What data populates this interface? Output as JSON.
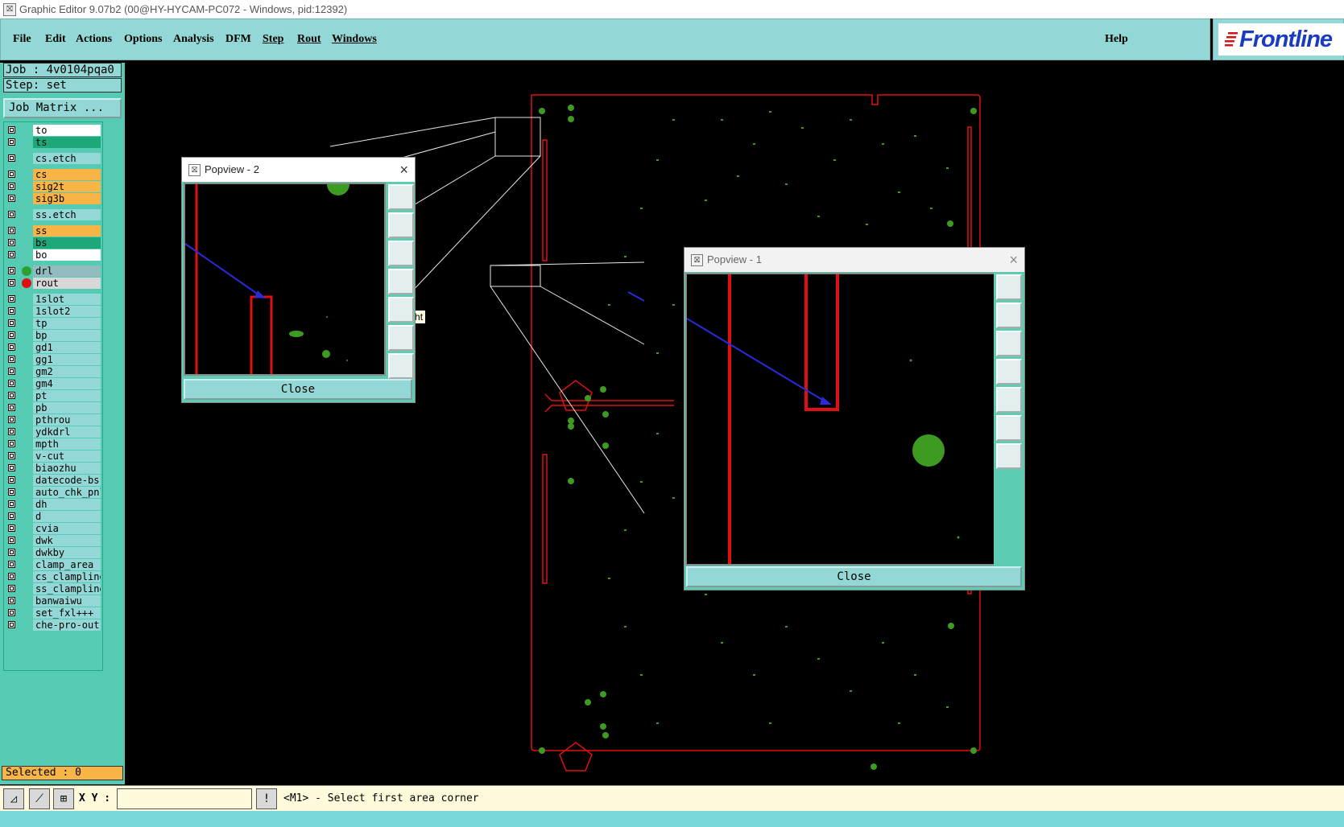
{
  "window": {
    "title": "Graphic Editor 9.07b2 (00@HY-HYCAM-PC072 - Windows, pid:12392)"
  },
  "menu": {
    "items": [
      "File",
      "Edit",
      "Actions",
      "Options",
      "Analysis",
      "DFM",
      "Step",
      "Rout",
      "Windows"
    ],
    "help": "Help"
  },
  "logo": {
    "brand": "Frontline"
  },
  "job": {
    "label": "Job : 4v0104pqa0",
    "step": "Step: set",
    "matrix_button": "Job Matrix ..."
  },
  "layers": [
    {
      "name": "to",
      "color": "#ffffff",
      "dot": null
    },
    {
      "name": "ts",
      "color": "#1ea87a",
      "dot": null
    },
    {
      "name": "cs.etch",
      "color": "#93d8d6",
      "dot": null
    },
    {
      "name": "cs",
      "color": "#f7b547",
      "dot": null
    },
    {
      "name": "sig2t",
      "color": "#f7b547",
      "dot": null
    },
    {
      "name": "sig3b",
      "color": "#f7b547",
      "dot": null
    },
    {
      "name": "ss.etch",
      "color": "#93d8d6",
      "dot": null
    },
    {
      "name": "ss",
      "color": "#f7b547",
      "dot": null
    },
    {
      "name": "bs",
      "color": "#1ea87a",
      "dot": null
    },
    {
      "name": "bo",
      "color": "#ffffff",
      "dot": null
    },
    {
      "name": "drl",
      "color": "#93bcc0",
      "dot": "#2fa030"
    },
    {
      "name": "rout",
      "color": "#d8d8d8",
      "dot": "#e01010"
    },
    {
      "name": "1slot",
      "color": "#93d8d6",
      "dot": null
    },
    {
      "name": "1slot2",
      "color": "#93d8d6",
      "dot": null
    },
    {
      "name": "tp",
      "color": "#93d8d6",
      "dot": null
    },
    {
      "name": "bp",
      "color": "#93d8d6",
      "dot": null
    },
    {
      "name": "gd1",
      "color": "#93d8d6",
      "dot": null
    },
    {
      "name": "gg1",
      "color": "#93d8d6",
      "dot": null
    },
    {
      "name": "gm2",
      "color": "#93d8d6",
      "dot": null
    },
    {
      "name": "gm4",
      "color": "#93d8d6",
      "dot": null
    },
    {
      "name": "pt",
      "color": "#93d8d6",
      "dot": null
    },
    {
      "name": "pb",
      "color": "#93d8d6",
      "dot": null
    },
    {
      "name": "pthrou",
      "color": "#93d8d6",
      "dot": null
    },
    {
      "name": "ydkdrl",
      "color": "#93d8d6",
      "dot": null
    },
    {
      "name": "mpth",
      "color": "#93d8d6",
      "dot": null
    },
    {
      "name": "v-cut",
      "color": "#93d8d6",
      "dot": null
    },
    {
      "name": "biaozhu",
      "color": "#93d8d6",
      "dot": null
    },
    {
      "name": "datecode-bs",
      "color": "#93d8d6",
      "dot": null
    },
    {
      "name": "auto_chk_pnl",
      "color": "#93d8d6",
      "dot": null
    },
    {
      "name": "dh",
      "color": "#93d8d6",
      "dot": null
    },
    {
      "name": "d",
      "color": "#93d8d6",
      "dot": null
    },
    {
      "name": "cvia",
      "color": "#93d8d6",
      "dot": null
    },
    {
      "name": "dwk",
      "color": "#93d8d6",
      "dot": null
    },
    {
      "name": "dwkby",
      "color": "#93d8d6",
      "dot": null
    },
    {
      "name": "clamp_area",
      "color": "#93d8d6",
      "dot": null
    },
    {
      "name": "cs_clampline",
      "color": "#93d8d6",
      "dot": null
    },
    {
      "name": "ss_clampline",
      "color": "#93d8d6",
      "dot": null
    },
    {
      "name": "banwaiwu",
      "color": "#93d8d6",
      "dot": null
    },
    {
      "name": "set_fxl+++",
      "color": "#93d8d6",
      "dot": null
    },
    {
      "name": "che-pro-out",
      "color": "#93d8d6",
      "dot": null
    }
  ],
  "selected": "Selected : 0",
  "status": {
    "xy_label": "X Y :",
    "message": "<M1> - Select first area corner",
    "alert": "!"
  },
  "popview2": {
    "title": "Popview - 2",
    "close": "Close",
    "tooltip": "Pan right"
  },
  "popview1": {
    "title": "Popview - 1",
    "close": "Close"
  },
  "colors": {
    "accent": "#93d8d6",
    "panel": "#55cbb3",
    "board_outline": "#e01010",
    "copper": "#3e9b22",
    "selected": "#f7b547"
  }
}
